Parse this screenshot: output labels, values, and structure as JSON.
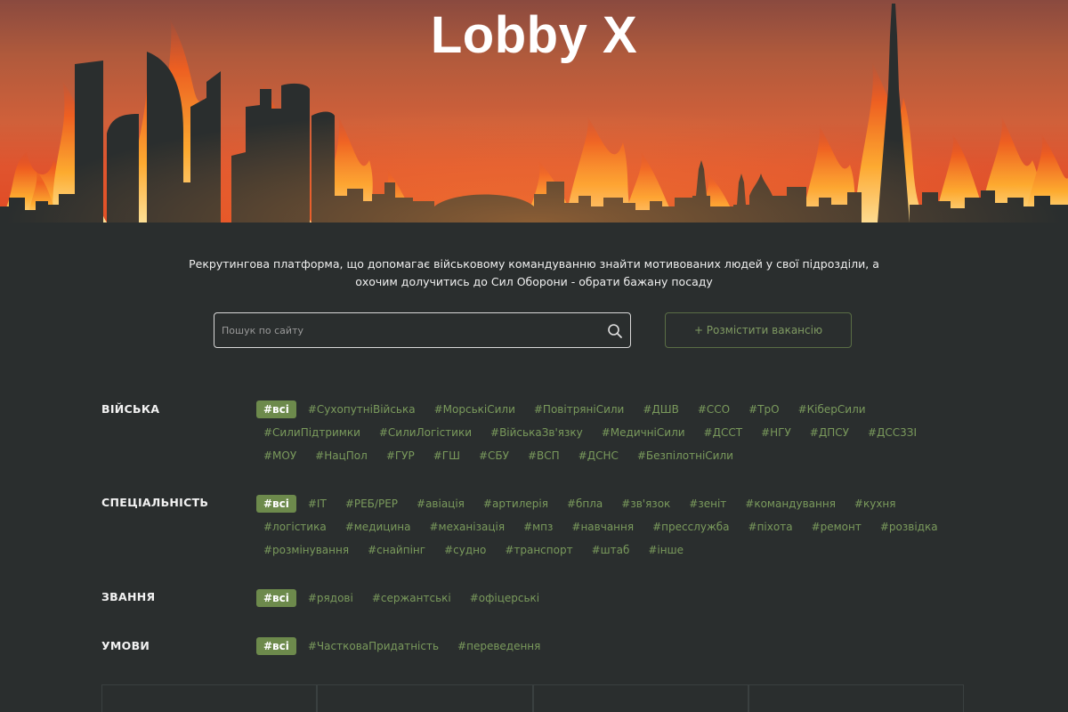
{
  "brand": {
    "logo": "Lobby X"
  },
  "tagline": {
    "line1": "Рекрутингова платформа, що допомагає військовому командуванню знайти мотивованих людей у свої підрозділи, а",
    "line2": "охочим долучитись до Сил Оборони - обрати бажану посаду"
  },
  "search": {
    "placeholder": "Пошук по сайту",
    "value": "",
    "icon": "search-icon"
  },
  "post_button": {
    "label": "+ Розмістити вакансію"
  },
  "filters": {
    "troops": {
      "label": "ВІЙСЬКА",
      "tags": [
        "#всі",
        "#СухопутніВійська",
        "#МорськіСили",
        "#ПовітряніСили",
        "#ДШВ",
        "#ССО",
        "#ТрО",
        "#КіберСили",
        "#СилиПідтримки",
        "#СилиЛогістики",
        "#ВійськаЗв'язку",
        "#МедичніСили",
        "#ДССТ",
        "#НГУ",
        "#ДПСУ",
        "#ДСС3ЗІ",
        "#МОУ",
        "#НацПол",
        "#ГУР",
        "#ГШ",
        "#СБУ",
        "#ВСП",
        "#ДСНС",
        "#БезпілотніСили"
      ]
    },
    "specialty": {
      "label": "СПЕЦІАЛЬНІСТЬ",
      "tags": [
        "#всі",
        "#IT",
        "#РЕБ/РЕР",
        "#авіація",
        "#артилерія",
        "#бпла",
        "#зв'язок",
        "#зеніт",
        "#командування",
        "#кухня",
        "#логістика",
        "#медицина",
        "#механізація",
        "#мпз",
        "#навчання",
        "#пресслужба",
        "#піхота",
        "#ремонт",
        "#розвідка",
        "#розмінування",
        "#снайпінг",
        "#судно",
        "#транспорт",
        "#штаб",
        "#інше"
      ]
    },
    "rank": {
      "label": "ЗВАННЯ",
      "tags": [
        "#всі",
        "#рядові",
        "#сержантські",
        "#офіцерські"
      ]
    },
    "conditions": {
      "label": "УМОВИ",
      "tags": [
        "#всі",
        "#ЧастковаПридатність",
        "#переведення"
      ]
    }
  },
  "colors": {
    "accent": "#6d8a4c",
    "tag_text": "#7a9a5c",
    "background": "#2a2e2e",
    "sky_bottom": "#e14a24"
  }
}
